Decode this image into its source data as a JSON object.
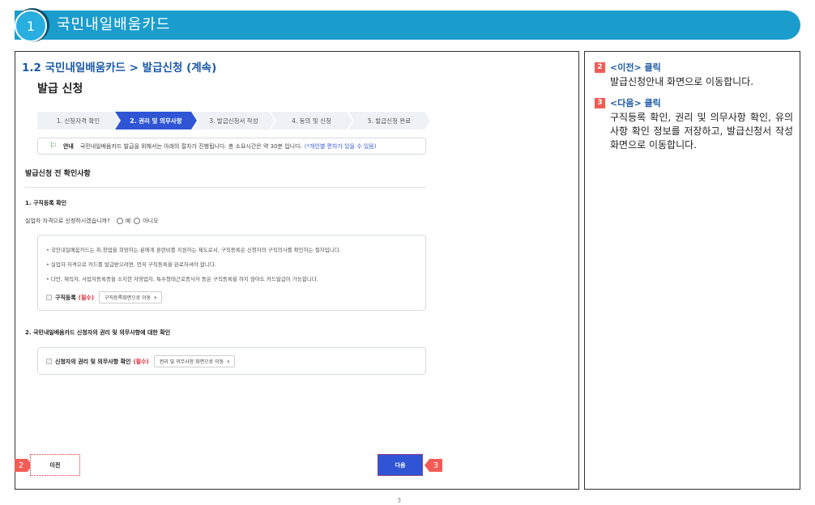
{
  "header": {
    "number": "1",
    "title": "국민내일배움카드"
  },
  "breadcrumb": "1.2 국민내일배움카드 > 발급신청 (계속)",
  "page_title": "발급 신청",
  "steps": [
    {
      "label": "1. 신청자격 확인",
      "active": false
    },
    {
      "label": "2. 권리 및 의무사항",
      "active": true
    },
    {
      "label": "3. 발급신청서 작성",
      "active": false
    },
    {
      "label": "4. 동의 및 신청",
      "active": false
    },
    {
      "label": "5. 발급신청 완료",
      "active": false
    }
  ],
  "notice": {
    "label": "안내",
    "text": "국민내일배움카드 발급을 위해서는 아래의 절차가 진행됩니다. 총 소요시간은 약 30분 입니다.",
    "highlight": "(*개인별 편차가 있을 수 있음)"
  },
  "section_title": "발급신청 전 확인사항",
  "job_registration": {
    "title": "1. 구직등록 확인",
    "question": "실업자 자격으로 신청하시겠습니까?",
    "options": [
      "예",
      "아니오"
    ],
    "bullets": [
      "• 국민내일배움카드는 취,창업을 희망하는 분에게 훈련비를 지원하는 제도로서, 구직등록은 신청자의 구직의사를 확인하는 절차입니다.",
      "• 실업자 자격으로 카드를 발급받으려면, 먼저 구직등록을 완료하셔야 합니다.",
      "• 다만, 재직자, 사업자등록증을 소지한 자영업자, 특수형태근로종사자 등은 구직등록을 하지 않아도 카드발급이 가능합니다."
    ],
    "check_label": "구직등록",
    "required": "(필수)",
    "link_label": "구직등록화면으로 이동"
  },
  "rights": {
    "title": "2. 국민내일배움카드 신청자의 권리 및 의무사항에 대한 확인",
    "check_label": "신청자의 권리 및 의무사항 확인",
    "required": "(필수)",
    "link_label": "권리 및 의무사항 화면으로 이동"
  },
  "buttons": {
    "prev": "이전",
    "next": "다음",
    "prev_marker": "2",
    "next_marker": "3"
  },
  "notes": [
    {
      "num": "2",
      "title": "<이전> 클릭",
      "body": "발급신청안내 화면으로 이동합니다."
    },
    {
      "num": "3",
      "title": "<다음> 클릭",
      "body": "구직등록 확인, 권리 및 의무사항 확인, 유의사항 확인 정보를 저장하고, 발급신청서 작성 화면으로 이동합니다."
    }
  ],
  "page_number": "3",
  "colors": {
    "header": "#1a9dcc",
    "accent": "#2f55d4",
    "marker": "#f25c55",
    "title_blue": "#1a59a8"
  }
}
